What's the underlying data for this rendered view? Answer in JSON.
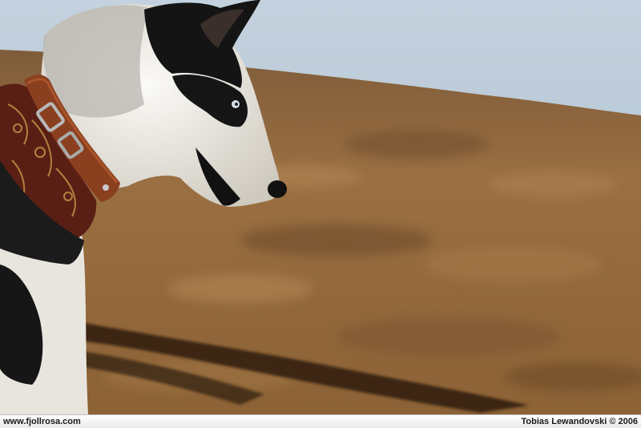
{
  "photo": {
    "subject": "dog-profile",
    "colors": {
      "sky": "#b9c9d6",
      "ground": "#9a6f3f",
      "shadow": "#2e1d10",
      "fur_white": "#ece9e2",
      "fur_black": "#151515",
      "collar": "#8a3f1f"
    }
  },
  "caption_bar": {
    "left_text": "www.fjollrosa.com",
    "right_text": "Tobias Lewandovski © 2006"
  }
}
